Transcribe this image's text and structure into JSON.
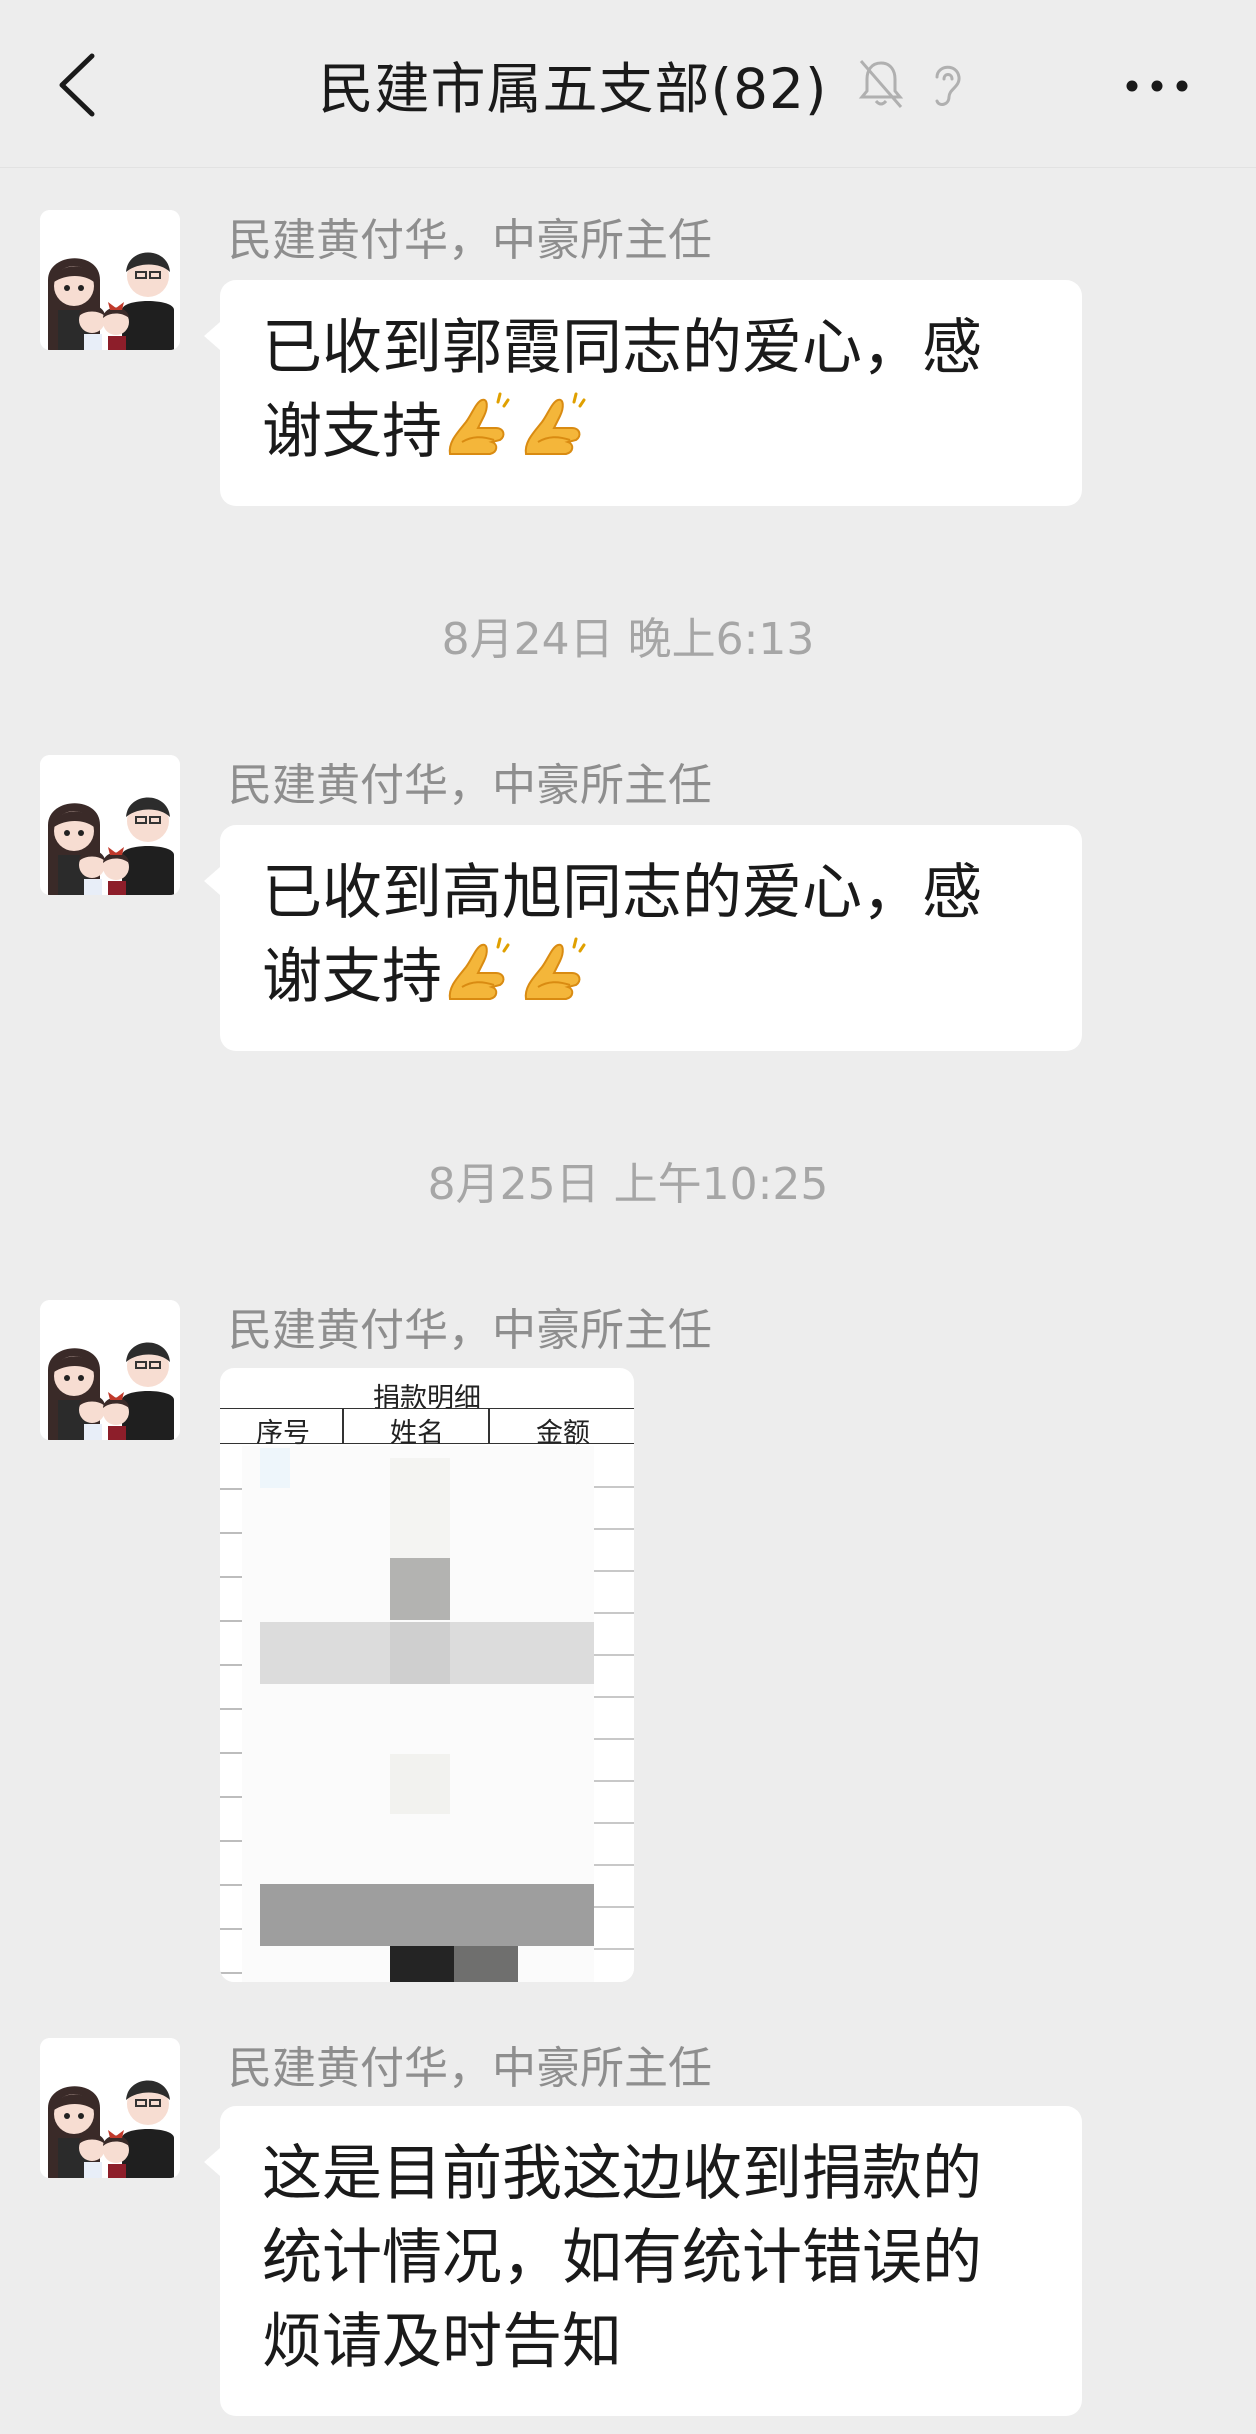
{
  "header": {
    "title": "民建市属五支部(82)",
    "back_icon": "back-chevron-icon",
    "mute_icon": "bell-muted-icon",
    "ear_icon": "ear-receiver-icon",
    "more_icon": "more-dots-icon"
  },
  "messages": [
    {
      "sender": "民建黄付华，中豪所主任",
      "text_line1": "已收到郭霞同志的爱心，感",
      "text_line2": "谢支持",
      "emoji": "folded-hands-icon"
    },
    {
      "timestamp": "8月24日 晚上6:13"
    },
    {
      "sender": "民建黄付华，中豪所主任",
      "text_line1": "已收到高旭同志的爱心，感",
      "text_line2": "谢支持",
      "emoji": "folded-hands-icon"
    },
    {
      "timestamp": "8月25日 上午10:25"
    },
    {
      "sender": "民建黄付华，中豪所主任",
      "image": {
        "title": "捐款明细",
        "columns": [
          "序号",
          "姓名",
          "金额"
        ]
      }
    },
    {
      "sender": "民建黄付华，中豪所主任",
      "text_line1": "这是目前我这边收到捐款的",
      "text_line2": "统计情况，如有统计错误的",
      "text_line3": "烦请及时告知"
    }
  ],
  "colors": {
    "background": "#ededed",
    "bubble": "#ffffff",
    "sender_text": "#8e8e8e",
    "timestamp_text": "#a6a6a6"
  }
}
